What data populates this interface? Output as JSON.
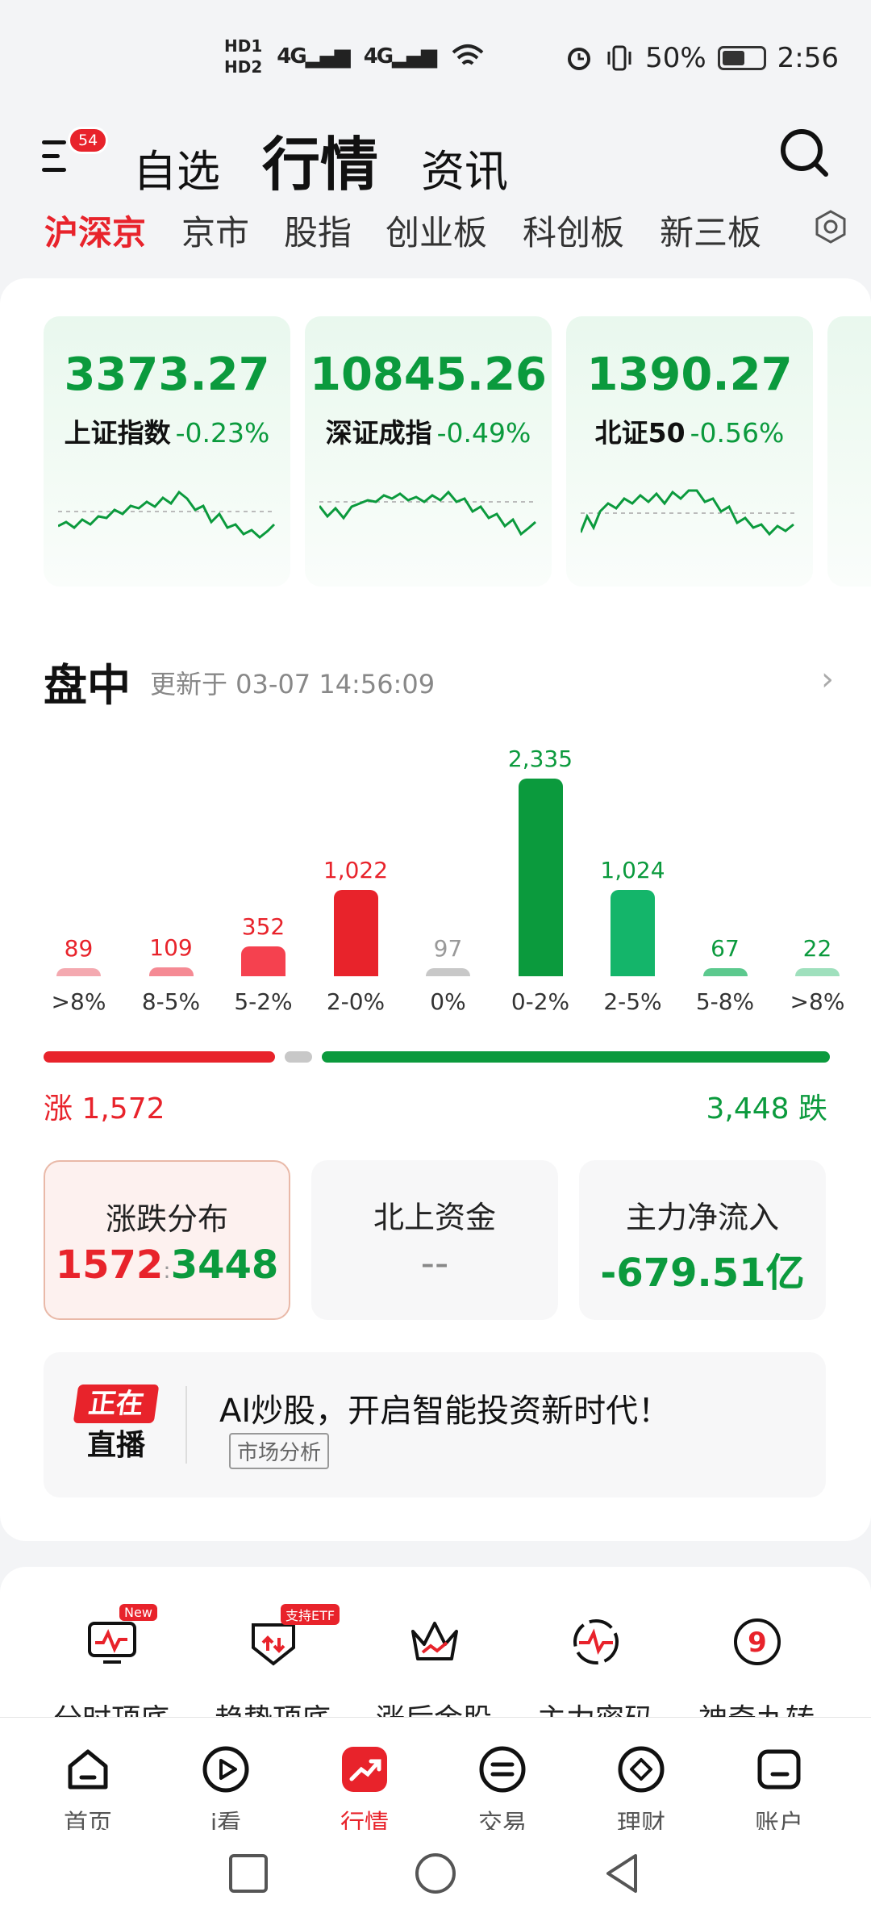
{
  "status_bar": {
    "hd1": "HD1",
    "hd2": "HD2",
    "net1": "4G",
    "net2": "4G",
    "battery": "50%",
    "time": "2:56"
  },
  "header": {
    "badge": "54",
    "tabs": [
      "自选",
      "行情",
      "资讯"
    ]
  },
  "subtabs": [
    "沪深京",
    "京市",
    "股指",
    "创业板",
    "科创板",
    "新三板"
  ],
  "indices": [
    {
      "value": "3373.27",
      "name": "上证指数",
      "change": "-0.23%"
    },
    {
      "value": "10845.26",
      "name": "深证成指",
      "change": "-0.49%"
    },
    {
      "value": "1390.27",
      "name": "北证50",
      "change": "-0.56%"
    }
  ],
  "section": {
    "title": "盘中",
    "updated": "更新于 03-07 14:56:09"
  },
  "chart_data": {
    "type": "bar",
    "categories": [
      ">8%",
      "8-5%",
      "5-2%",
      "2-0%",
      "0%",
      "0-2%",
      "2-5%",
      "5-8%",
      ">8%"
    ],
    "values": [
      89,
      109,
      352,
      1022,
      97,
      2335,
      1024,
      67,
      22
    ],
    "value_labels": [
      "89",
      "109",
      "352",
      "1,022",
      "97",
      "2,335",
      "1,024",
      "67",
      "22"
    ],
    "colors": [
      "#f4a9b0",
      "#f58a94",
      "#f5414f",
      "#e8232b",
      "#c8c8c8",
      "#0b9a3d",
      "#14b56a",
      "#5cc98e",
      "#9fe0bd"
    ],
    "label_colors": [
      "#e8232b",
      "#e8232b",
      "#e8232b",
      "#e8232b",
      "#999999",
      "#0b9a3d",
      "#0b9a3d",
      "#0b9a3d",
      "#0b9a3d"
    ]
  },
  "ratio": {
    "up": 1572,
    "flat": 97,
    "down": 3448,
    "up_label": "涨 1,572",
    "down_label": "3,448 跌"
  },
  "stats": [
    {
      "title": "涨跌分布",
      "up": "1572",
      "sep": ":",
      "down": "3448"
    },
    {
      "title": "北上资金",
      "value": "--"
    },
    {
      "title": "主力净流入",
      "value": "-679.51亿"
    }
  ],
  "live": {
    "logo_top": "正在",
    "logo_bottom": "直播",
    "title": "AI炒股，开启智能投资新时代！",
    "tag": "市场分析"
  },
  "tools": [
    {
      "name": "分时顶底",
      "tag": "New"
    },
    {
      "name": "趋势顶底",
      "tag": "支持ETF"
    },
    {
      "name": "涨后金股",
      "tag": ""
    },
    {
      "name": "主力密码",
      "tag": ""
    },
    {
      "name": "神奇九转",
      "tag": ""
    }
  ],
  "nav": [
    "首页",
    "i看",
    "行情",
    "交易",
    "理财",
    "账户"
  ],
  "colors": {
    "red": "#e8232b",
    "green": "#0b9a3d"
  }
}
